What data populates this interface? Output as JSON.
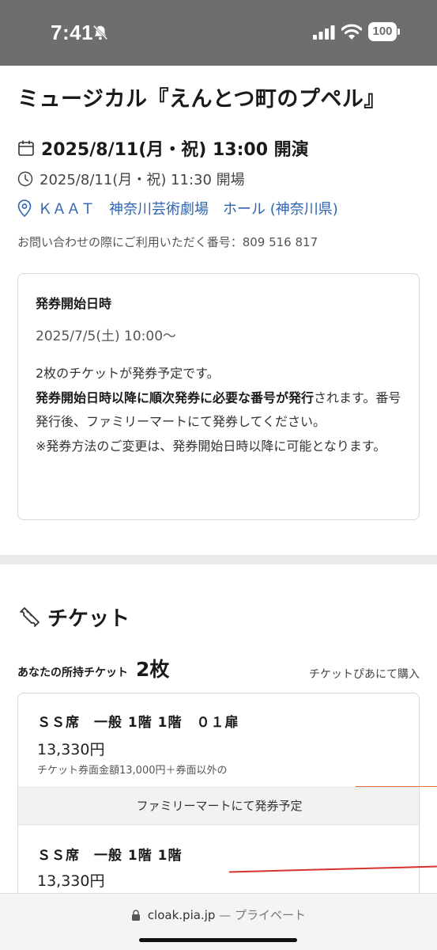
{
  "status_bar": {
    "time": "7:41",
    "battery": "100",
    "icons": [
      "bell-slash-icon",
      "cellular-signal-icon",
      "wifi-icon",
      "battery-icon"
    ]
  },
  "event": {
    "title": "ミュージカル『えんとつ町のプペル』",
    "show_time": "2025/8/11(月・祝) 13:00 開演",
    "open_time": "2025/8/11(月・祝) 11:30 開場",
    "venue": "ＫＡＡＴ　神奈川芸術劇場　ホール (神奈川県)",
    "inquiry": "お問い合わせの際にご利用いただく番号：809 516 817"
  },
  "issue_info": {
    "heading": "発券開始日時",
    "date": "2025/7/5(土) 10:00～",
    "line1": "2枚のチケットが発券予定です。",
    "bold_part": "発券開始日時以降に順次発券に必要な番号が発行",
    "normal_part": "されます。番号発行後、ファミリーマートにて発券してください。",
    "note": "※発券方法のご変更は、発券開始日時以降に可能となります。"
  },
  "tickets": {
    "heading": "チケット",
    "owned_label": "あなたの所持チケット",
    "owned_count": "2枚",
    "buy_link": "チケットぴあにて購入",
    "items": [
      {
        "seat": "ＳＳ席　一般 1階 1階　０１扉",
        "price": "13,330円",
        "note": "チケット券面金額13,000円＋券面以外の"
      },
      {
        "seat": "ＳＳ席　一般 1階 1階",
        "price": "13,330円"
      }
    ],
    "pickup_status": "ファミリーマートにて発券予定"
  },
  "browser": {
    "url": "cloak.pia.jp",
    "mode": "— プライベート"
  },
  "colors": {
    "status_bar": "#6e6e6e",
    "link": "#2f64b0",
    "section_gap": "#ebebeb"
  }
}
